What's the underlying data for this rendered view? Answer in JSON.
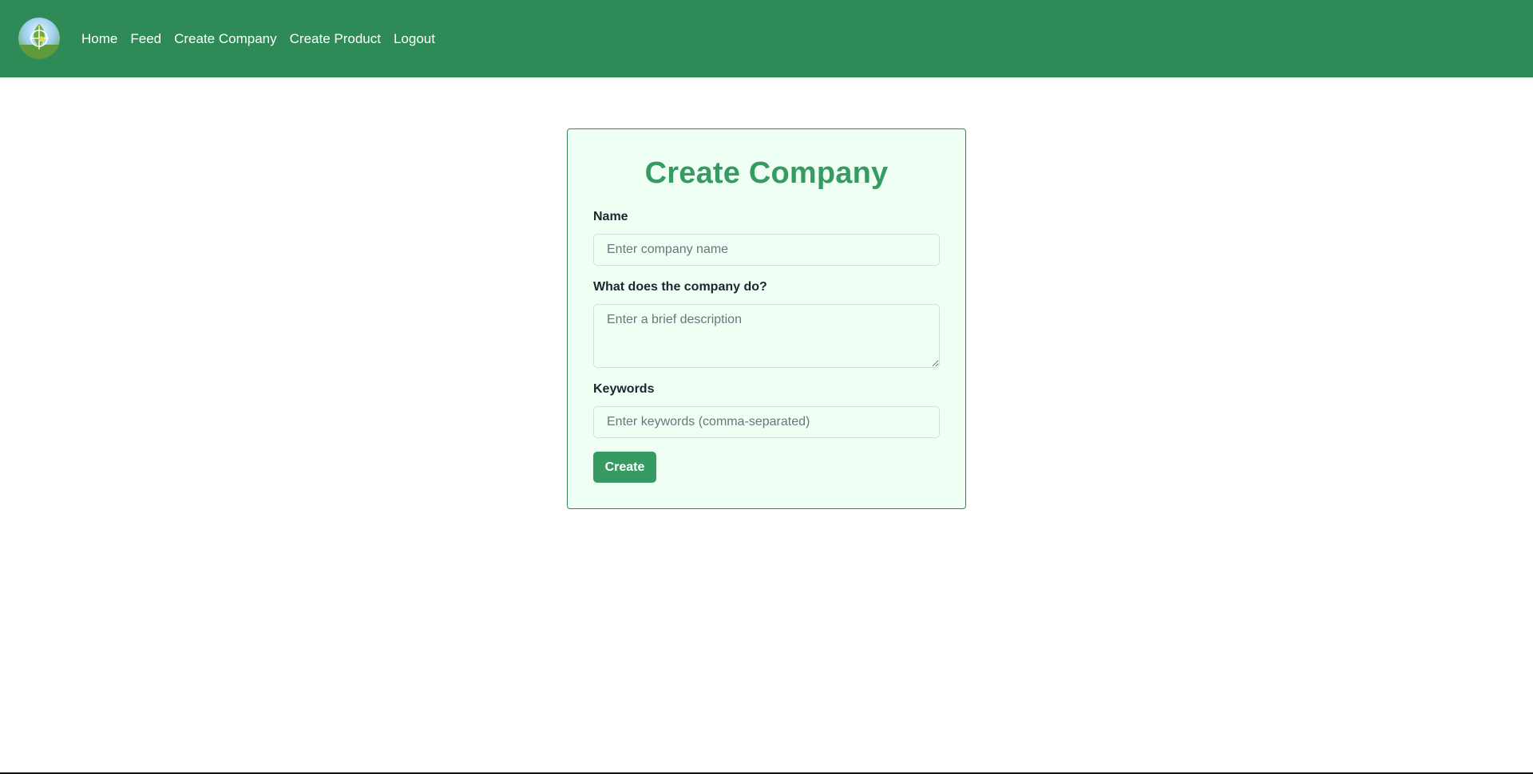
{
  "nav": {
    "logo_icon": "leaf-globe-logo-icon",
    "links": [
      {
        "label": "Home"
      },
      {
        "label": "Feed"
      },
      {
        "label": "Create Company"
      },
      {
        "label": "Create Product"
      },
      {
        "label": "Logout"
      }
    ]
  },
  "form": {
    "title": "Create Company",
    "name_label": "Name",
    "name_placeholder": "Enter company name",
    "name_value": "",
    "description_label": "What does the company do?",
    "description_placeholder": "Enter a brief description",
    "description_value": "",
    "keywords_label": "Keywords",
    "keywords_placeholder": "Enter keywords (comma-separated)",
    "keywords_value": "",
    "submit_label": "Create"
  },
  "colors": {
    "navbar": "#2e8b57",
    "accent": "#369b63",
    "card_background": "#effff3"
  }
}
